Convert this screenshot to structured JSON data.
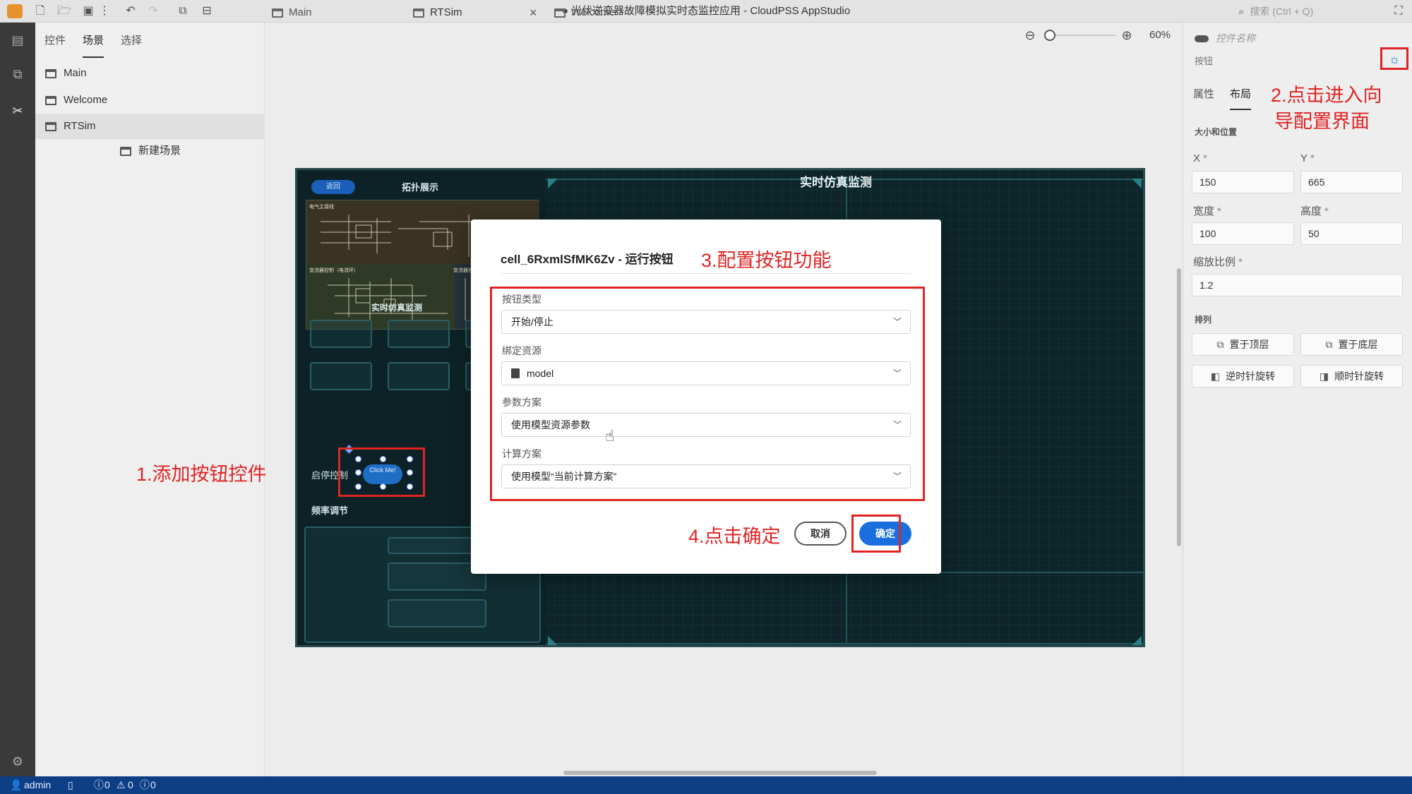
{
  "window": {
    "title": "● 光伏逆变器故障模拟实时态监控应用 - CloudPSS AppStudio",
    "search_placeholder": "搜索 (Ctrl + Q)"
  },
  "icons": {
    "toolbar": [
      "new-file-icon",
      "open-folder-icon",
      "save-icon",
      "more-icon",
      "undo-icon",
      "redo-icon",
      "preview-icon",
      "publish-icon"
    ],
    "activity": [
      "components-icon",
      "resources-icon",
      "tools-icon",
      "settings-icon"
    ]
  },
  "left_panel": {
    "tabs": [
      "控件",
      "场景",
      "选择"
    ],
    "active_tab": "场景",
    "tree": [
      "Main",
      "Welcome",
      "RTSim",
      "新建场景"
    ],
    "selected": "RTSim"
  },
  "editor": {
    "tabs": [
      "Main",
      "RTSim",
      "Welcome"
    ],
    "active_tab": "RTSim",
    "close_glyph": "×",
    "zoom_level": "60%",
    "zoom_fraction": 0.0
  },
  "scene": {
    "pill": "返回",
    "topo_title": "拓扑展示",
    "topo_sub1": "电气主接线",
    "topo_sub2": "变流器控制（电流环）",
    "topo_sub3": "变流器控",
    "main_title": "实时仿真监测",
    "sub_title": "实时仿真监测",
    "start_label": "启停控制",
    "freq_label": "频率调节",
    "button_text": "Click Me!",
    "accent_color": "#0d2529"
  },
  "annotations": {
    "a1": "1.添加按钮控件",
    "a2_line1": "2.点击进入向",
    "a2_line2": "导配置界面",
    "a3": "3.配置按钮功能",
    "a4": "4.点击确定",
    "color": "#e02424"
  },
  "dialog": {
    "title": "cell_6RxmlSfMK6Zv - 运行按钮",
    "fields": [
      {
        "label": "按钮类型",
        "value": "开始/停止"
      },
      {
        "label": "绑定资源",
        "value": "model"
      },
      {
        "label": "参数方案",
        "value": "使用模型资源参数"
      },
      {
        "label": "计算方案",
        "value": "使用模型“当前计算方案”"
      }
    ],
    "cancel": "取消",
    "ok": "确定",
    "ok_color": "#1a6fdf"
  },
  "props": {
    "name_placeholder": "控件名称",
    "type": "按钮",
    "tabs": [
      "属性",
      "布局"
    ],
    "active_tab": "布局",
    "section_size": "大小和位置",
    "x_label": "X",
    "y_label": "Y",
    "x": "150",
    "y": "665",
    "width_label": "宽度",
    "height_label": "高度",
    "width": "100",
    "height": "50",
    "scale_label": "缩放比例",
    "scale": "1.2",
    "required_mark": "*",
    "section_arrange": "排列",
    "to_top": "置于顶层",
    "to_bottom": "置于底层",
    "rotate_ccw": "逆时针旋转",
    "rotate_cw": "顺时针旋转"
  },
  "status": {
    "user": "admin",
    "errors": "0",
    "warnings": "0",
    "infos": "0",
    "bar_color": "#0e3f86"
  }
}
